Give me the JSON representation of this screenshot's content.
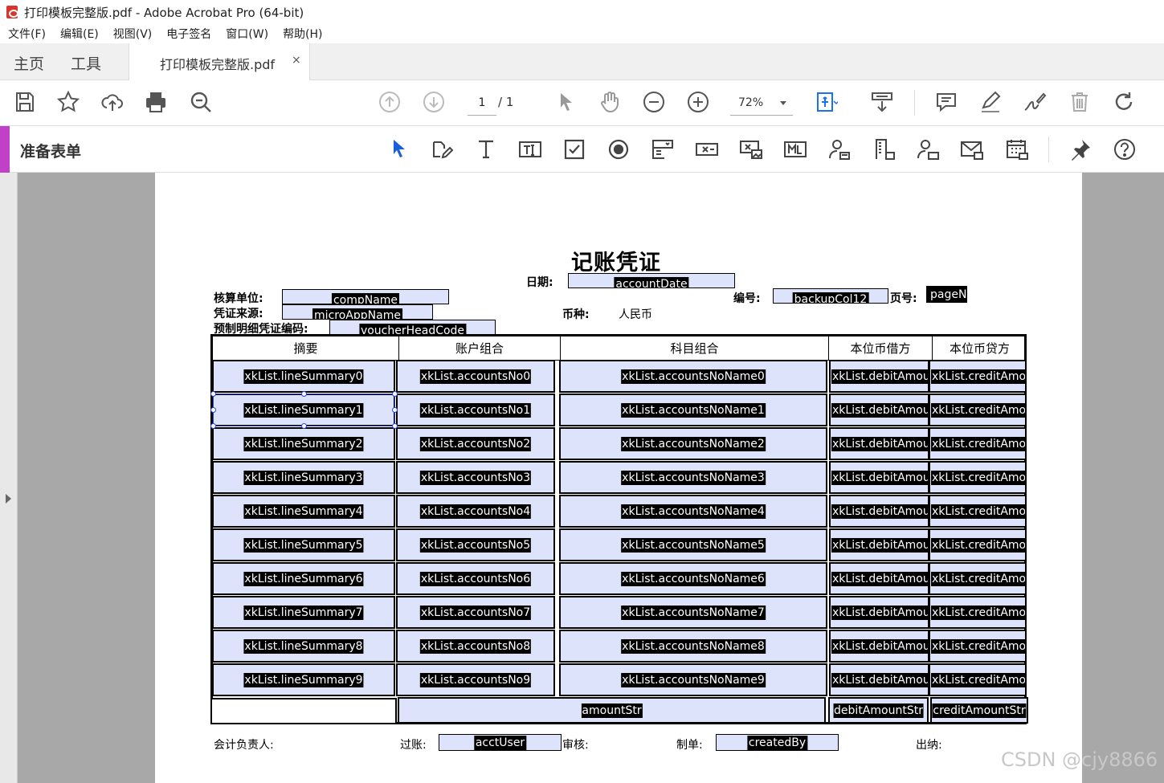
{
  "window": {
    "title": "打印模板完整版.pdf - Adobe Acrobat Pro (64-bit)"
  },
  "menu": [
    "文件(F)",
    "编辑(E)",
    "视图(V)",
    "电子签名",
    "窗口(W)",
    "帮助(H)"
  ],
  "tabs": {
    "home": "主页",
    "tools": "工具",
    "doc": "打印模板完整版.pdf",
    "close": "×"
  },
  "toolbar": {
    "page_current": "1",
    "page_total": "/ 1",
    "zoom": "72%"
  },
  "formbar": {
    "label": "准备表单"
  },
  "doc": {
    "title": "记账凭证",
    "date_label": "日期:",
    "date_field": "accountDate",
    "unit_label": "核算单位:",
    "unit_field": "compName",
    "source_label": "凭证来源:",
    "source_field": "microAppName",
    "code_label": "预制明细凭证编码:",
    "code_field": "voucherHeadCode",
    "currency_label": "币种:",
    "currency_value": "人民币",
    "number_label": "编号:",
    "number_field": "backupCol12",
    "page_label": "页号:",
    "page_field": "pageN",
    "headers": [
      "摘要",
      "账户组合",
      "科目组合",
      "本位币借方",
      "本位币贷方"
    ],
    "rows": [
      {
        "summary": "xkList.lineSummary0",
        "account": "xkList.accountsNo0",
        "name": "xkList.accountsNoName0",
        "debit": "xkList.debitAmour",
        "credit": "xkList.creditAmou"
      },
      {
        "summary": "xkList.lineSummary1",
        "account": "xkList.accountsNo1",
        "name": "xkList.accountsNoName1",
        "debit": "xkList.debitAmour",
        "credit": "xkList.creditAmou"
      },
      {
        "summary": "xkList.lineSummary2",
        "account": "xkList.accountsNo2",
        "name": "xkList.accountsNoName2",
        "debit": "xkList.debitAmour",
        "credit": "xkList.creditAmou"
      },
      {
        "summary": "xkList.lineSummary3",
        "account": "xkList.accountsNo3",
        "name": "xkList.accountsNoName3",
        "debit": "xkList.debitAmour",
        "credit": "xkList.creditAmou"
      },
      {
        "summary": "xkList.lineSummary4",
        "account": "xkList.accountsNo4",
        "name": "xkList.accountsNoName4",
        "debit": "xkList.debitAmour",
        "credit": "xkList.creditAmou"
      },
      {
        "summary": "xkList.lineSummary5",
        "account": "xkList.accountsNo5",
        "name": "xkList.accountsNoName5",
        "debit": "xkList.debitAmour",
        "credit": "xkList.creditAmou"
      },
      {
        "summary": "xkList.lineSummary6",
        "account": "xkList.accountsNo6",
        "name": "xkList.accountsNoName6",
        "debit": "xkList.debitAmour",
        "credit": "xkList.creditAmou"
      },
      {
        "summary": "xkList.lineSummary7",
        "account": "xkList.accountsNo7",
        "name": "xkList.accountsNoName7",
        "debit": "xkList.debitAmour",
        "credit": "xkList.creditAmou"
      },
      {
        "summary": "xkList.lineSummary8",
        "account": "xkList.accountsNo8",
        "name": "xkList.accountsNoName8",
        "debit": "xkList.debitAmour",
        "credit": "xkList.creditAmou"
      },
      {
        "summary": "xkList.lineSummary9",
        "account": "xkList.accountsNo9",
        "name": "xkList.accountsNoName9",
        "debit": "xkList.debitAmour",
        "credit": "xkList.creditAmou"
      }
    ],
    "totals": {
      "amount": "amountStr",
      "debit": "debitAmountStr",
      "credit": "creditAmountStr"
    },
    "footer": {
      "accountant_label": "会计负责人:",
      "posting_label": "过账:",
      "posting_field": "acctUser",
      "review_label": "审核:",
      "maker_label": "制单:",
      "maker_field": "createdBy",
      "cashier_label": "出纳:"
    }
  },
  "watermark": "CSDN @cjy8866",
  "icons": {
    "toolbar": [
      "save-icon",
      "star-icon",
      "upload-icon",
      "print-icon",
      "zoom-search-icon",
      "page-up-icon",
      "page-down-icon",
      "select-arrow-icon",
      "hand-icon",
      "zoom-out-icon",
      "zoom-in-icon",
      "fit-page-icon",
      "scroll-mode-icon",
      "comment-icon",
      "highlight-pen-icon",
      "sign-icon",
      "delete-icon",
      "rotate-icon"
    ],
    "formbar": [
      "cursor-icon",
      "edit-form-icon",
      "text-icon",
      "text-field-icon",
      "checkbox-icon",
      "radio-icon",
      "listbox-icon",
      "button-field-icon",
      "image-field-icon",
      "barcode-icon",
      "person-icon",
      "building-icon",
      "person-alt-icon",
      "email-icon",
      "calendar-icon",
      "pin-icon",
      "help-icon"
    ]
  }
}
